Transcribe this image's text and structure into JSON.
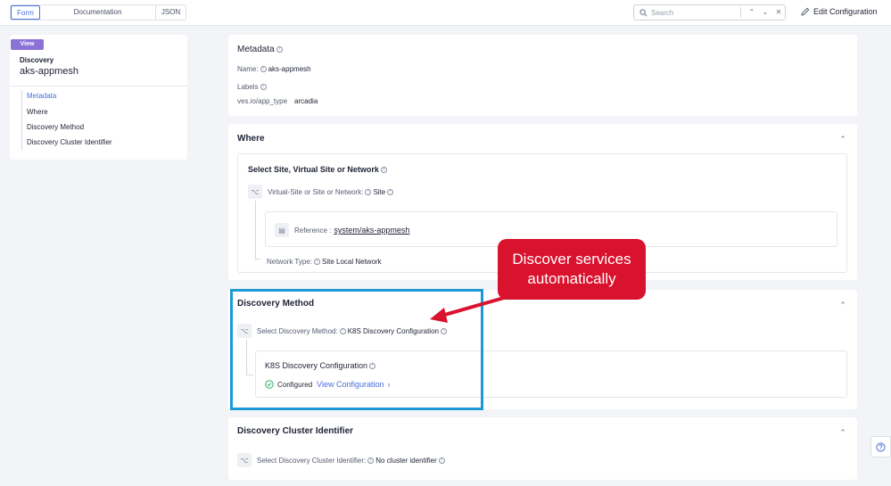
{
  "tabs": {
    "form": "Form",
    "documentation": "Documentation",
    "json": "JSON"
  },
  "search": {
    "placeholder": "Search"
  },
  "toolbar": {
    "edit_configuration": "Edit Configuration"
  },
  "sidebar": {
    "badge": "View",
    "object_type": "Discovery",
    "object_name": "aks-appmesh",
    "items": [
      {
        "label": "Metadata"
      },
      {
        "label": "Where"
      },
      {
        "label": "Discovery Method"
      },
      {
        "label": "Discovery Cluster Identifier"
      }
    ]
  },
  "metadata": {
    "title": "Metadata",
    "name_label": "Name:",
    "name_value": "aks-appmesh",
    "labels_label": "Labels",
    "label_key": "ves.io/app_type",
    "label_value": "arcadia"
  },
  "where": {
    "title": "Where",
    "select_title": "Select Site, Virtual Site or Network",
    "choice_label": "Virtual-Site or Site or Network:",
    "choice_value": "Site",
    "reference_label": "Reference :",
    "reference_value": "system/aks-appmesh",
    "network_type_label": "Network Type:",
    "network_type_value": "Site Local Network"
  },
  "discovery_method": {
    "title": "Discovery Method",
    "select_label": "Select Discovery Method:",
    "select_value": "K8S Discovery Configuration",
    "sub_title": "K8S Discovery Configuration",
    "status": "Configured",
    "view_link": "View Configuration"
  },
  "cluster_identifier": {
    "title": "Discovery Cluster Identifier",
    "select_label": "Select Discovery Cluster Identifier:",
    "select_value": "No cluster identifier"
  },
  "annotation": {
    "callout_line1": "Discover services",
    "callout_line2": "automatically",
    "highlight_color": "#1c9ad6",
    "callout_color": "#d9122e"
  },
  "colors": {
    "accent": "#4b6fd8",
    "badge": "#8a72d6",
    "success": "#2fb36b"
  }
}
